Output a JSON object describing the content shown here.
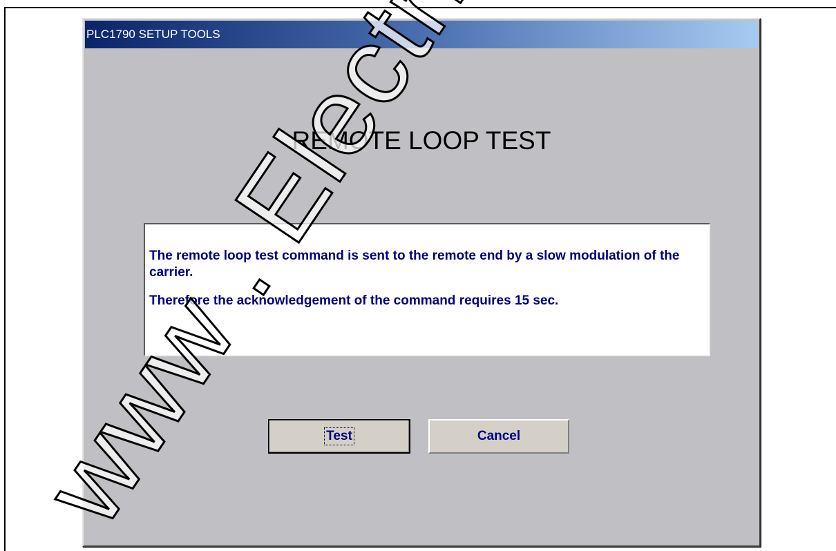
{
  "window": {
    "title": "PLC1790 SETUP TOOLS"
  },
  "dialog": {
    "heading": "REMOTE LOOP TEST",
    "message": {
      "paragraph1": "The  remote loop test command is sent to the remote end by a slow modulation of the carrier.",
      "paragraph2": "Therefore  the  acknowledgement  of  the command requires 15 sec."
    },
    "buttons": {
      "test_label": "Test",
      "cancel_label": "Cancel"
    }
  },
  "watermark": {
    "text": "www . Electrical"
  },
  "colors": {
    "title_gradient_start": "#0a246a",
    "title_gradient_end": "#a6caf0",
    "dialog_background": "#c0bfc3",
    "message_text": "#000080",
    "button_text": "#000080"
  }
}
